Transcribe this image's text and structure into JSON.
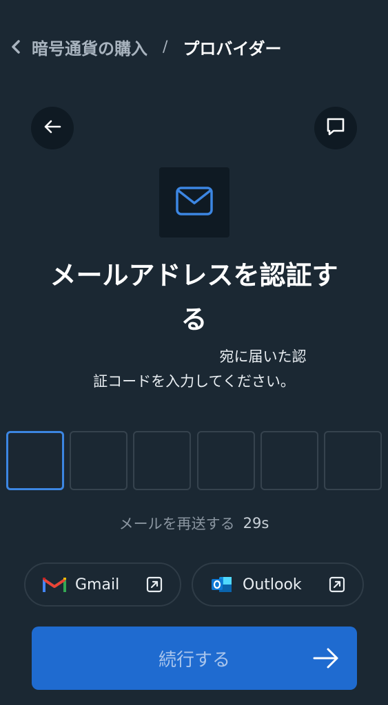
{
  "breadcrumb": {
    "parent": "暗号通貨の購入",
    "separator": "/",
    "current": "プロバイダー"
  },
  "header": {
    "title_line1": "メールアドレスを認証す",
    "title_line2": "る",
    "subtitle_line1": "宛に届いた認",
    "subtitle_line2": "証コードを入力してください。"
  },
  "otp": {
    "boxes": [
      "",
      "",
      "",
      "",
      "",
      ""
    ]
  },
  "resend": {
    "label": "メールを再送する",
    "timer": "29s"
  },
  "mail_apps": {
    "gmail_label": "Gmail",
    "outlook_label": "Outlook"
  },
  "continue_button": {
    "label": "続行する"
  },
  "colors": {
    "background": "#1b2833",
    "accent": "#1f6bd0",
    "focus": "#3c86e2"
  },
  "icons": {
    "breadcrumb_back": "chevron-left-icon",
    "back": "arrow-left-icon",
    "chat": "chat-bubble-icon",
    "mail": "envelope-icon",
    "gmail": "gmail-logo-icon",
    "outlook": "outlook-logo-icon",
    "external": "external-link-icon",
    "continue": "arrow-right-icon"
  }
}
